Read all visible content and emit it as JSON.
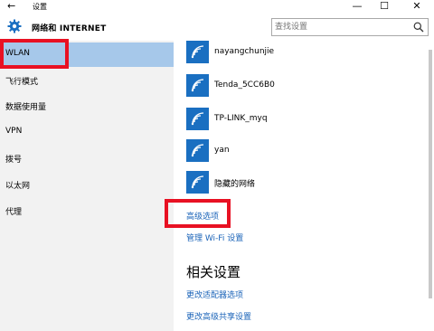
{
  "window": {
    "back_glyph": "←",
    "title": "设置",
    "minimize_glyph": "—",
    "maximize_glyph": "☐",
    "close_glyph": "✕"
  },
  "header": {
    "icon": "gear-icon",
    "title": "网络和 INTERNET",
    "search_placeholder": "查找设置"
  },
  "sidebar": {
    "items": [
      {
        "label": "WLAN",
        "active": true
      },
      {
        "label": "飞行模式"
      },
      {
        "label": "数据使用量"
      },
      {
        "label": "VPN"
      },
      {
        "label": "拨号"
      },
      {
        "label": "以太网"
      },
      {
        "label": "代理"
      }
    ]
  },
  "networks": [
    {
      "name": "nayangchunjie"
    },
    {
      "name": "Tenda_5CC6B0"
    },
    {
      "name": "TP-LINK_myq"
    },
    {
      "name": "yan"
    },
    {
      "name": "隐藏的网络"
    }
  ],
  "links": {
    "advanced": "高级选项",
    "manage_wifi": "管理 Wi-Fi 设置"
  },
  "related": {
    "title": "相关设置",
    "items": [
      "更改适配器选项",
      "更改高级共享设置"
    ]
  },
  "colors": {
    "accent": "#1a6fc1",
    "link": "#1a63b8",
    "sidebar_active": "#a6c8ea",
    "highlight_box": "#e81123"
  }
}
